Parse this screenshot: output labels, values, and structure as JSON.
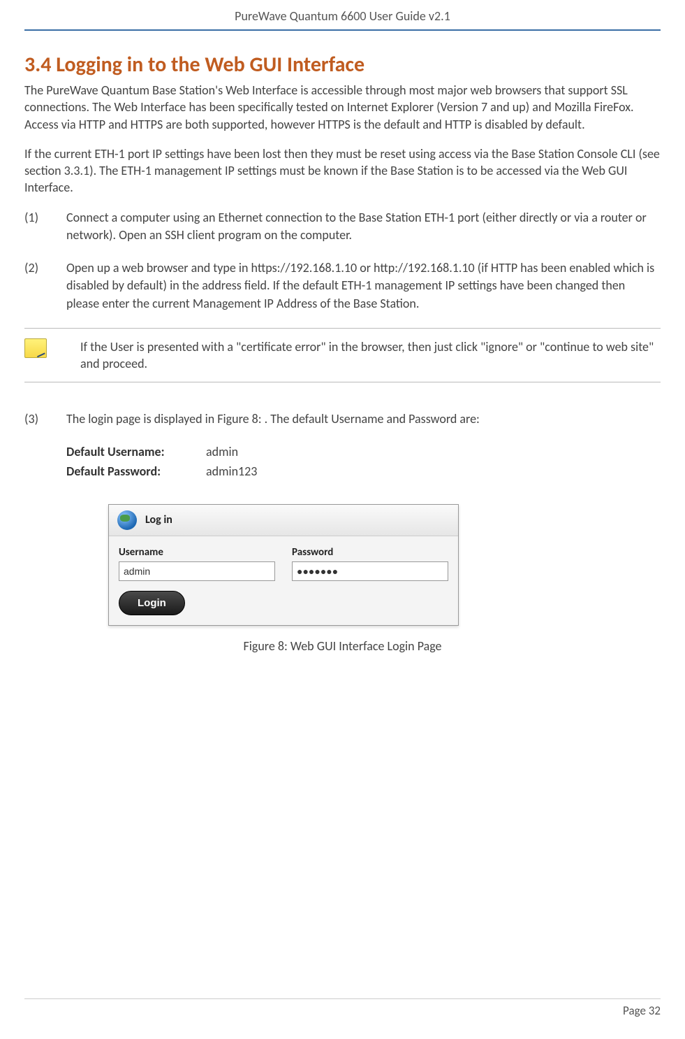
{
  "header": {
    "title": "PureWave Quantum 6600 User Guide v2.1"
  },
  "section": {
    "number": "3.4",
    "title": "Logging in to the Web GUI Interface"
  },
  "paragraphs": {
    "p1": "The PureWave Quantum Base Station's Web Interface is accessible through most major web browsers that support SSL connections. The Web Interface has been specifically tested on Internet Explorer (Version 7 and up) and Mozilla FireFox. Access via HTTP and HTTPS are both supported, however HTTPS is the default and HTTP is disabled by default.",
    "p2": "If the current ETH-1 port IP settings have been lost then they must be reset using access via the Base Station Console CLI (see section 3.3.1). The ETH-1 management IP settings must be known if the Base Station is to be accessed via the Web GUI Interface."
  },
  "steps": [
    {
      "num": "(1)",
      "text": "Connect a computer using an Ethernet connection to the Base Station ETH-1 port (either directly or via a router or network). Open an SSH client program on the computer."
    },
    {
      "num": "(2)",
      "text": "Open up a web browser and type in https://192.168.1.10 or http://192.168.1.10 (if HTTP has been enabled which is disabled by default) in the address field. If the default ETH-1 management IP settings have been changed then please enter the current Management IP Address of the Base Station."
    },
    {
      "num": "(3)",
      "text": "The login page is displayed in Figure 8: . The default Username and Password are:"
    }
  ],
  "note": {
    "text": "If the User is presented with a \"certificate error\" in the browser, then just click \"ignore\" or \"continue to web site\" and proceed."
  },
  "credentials": {
    "username_label": "Default Username:",
    "username_value": "admin",
    "password_label": "Default Password:",
    "password_value": "admin123"
  },
  "login_widget": {
    "title": "Log in",
    "username_label": "Username",
    "username_value": "admin",
    "password_label": "Password",
    "password_value": "●●●●●●●",
    "button_label": "Login"
  },
  "figure_caption": "Figure 8: Web GUI Interface Login Page",
  "footer": {
    "page": "Page 32"
  }
}
